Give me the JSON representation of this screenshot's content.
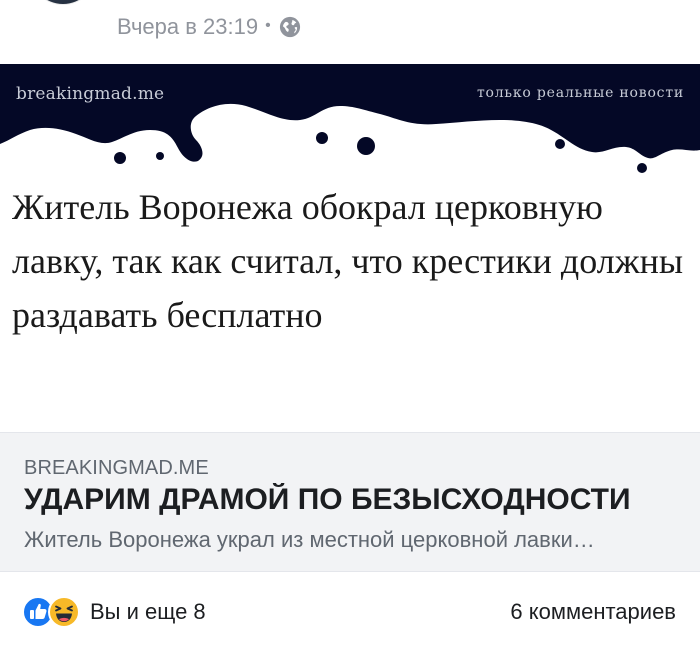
{
  "post": {
    "timestamp": "Вчера в 23:19",
    "separator": "•",
    "audience_icon": "globe-icon"
  },
  "link_image": {
    "site_wordmark": "breakingmad.me",
    "tagline": "только реальные новости",
    "headline": "Житель Воронежа обокрал церковную лавку, так как считал, что крестики должны раздавать бесплатно",
    "band_color": "#040826"
  },
  "link_info": {
    "domain": "BREAKINGMAD.ME",
    "title": "УДАРИМ ДРАМОЙ ПО БЕЗЫСХОДНОСТИ",
    "description": "Житель Воронежа украл из местной церковной лавки"
  },
  "reactions": {
    "icons": [
      "like-icon",
      "haha-icon"
    ],
    "text": "Вы и еще 8",
    "comments": "6 комментариев",
    "like_color": "#1877f2",
    "haha_color": "#f7b928"
  }
}
